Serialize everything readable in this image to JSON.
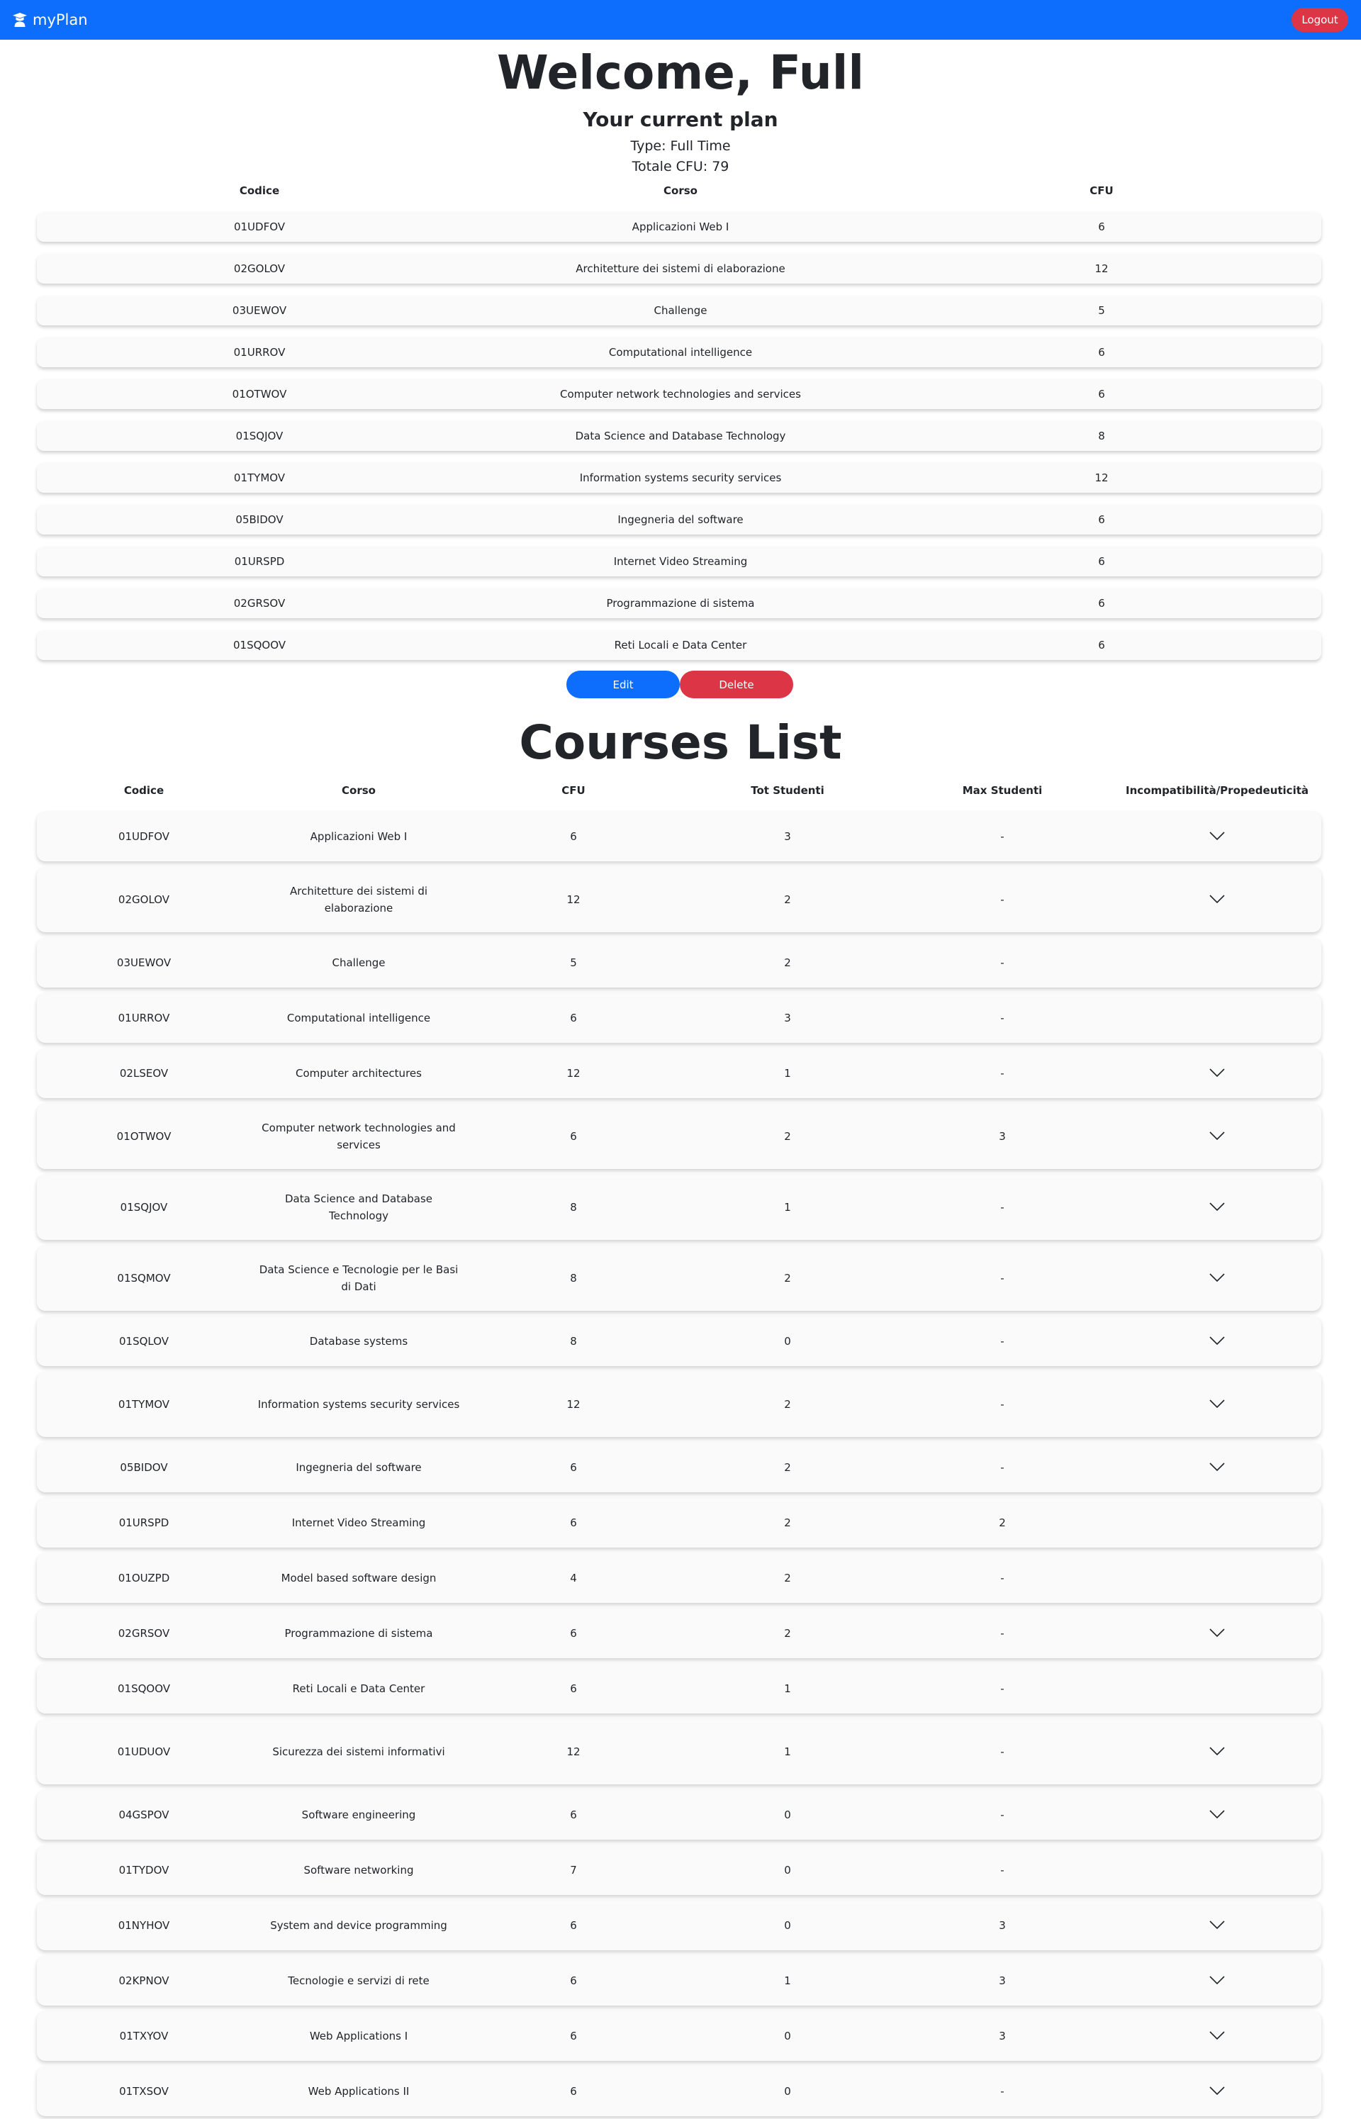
{
  "navbar": {
    "brand": "myPlan",
    "logout": "Logout"
  },
  "welcome": "Welcome, Full",
  "plan": {
    "title": "Your current plan",
    "type": "Type: Full Time",
    "total": "Totale CFU: 79",
    "headers": {
      "code": "Codice",
      "name": "Corso",
      "cfu": "CFU"
    },
    "rows": [
      {
        "code": "01UDFOV",
        "name": "Applicazioni Web I",
        "cfu": "6"
      },
      {
        "code": "02GOLOV",
        "name": "Architetture dei sistemi di elaborazione",
        "cfu": "12"
      },
      {
        "code": "03UEWOV",
        "name": "Challenge",
        "cfu": "5"
      },
      {
        "code": "01URROV",
        "name": "Computational intelligence",
        "cfu": "6"
      },
      {
        "code": "01OTWOV",
        "name": "Computer network technologies and services",
        "cfu": "6"
      },
      {
        "code": "01SQJOV",
        "name": "Data Science and Database Technology",
        "cfu": "8"
      },
      {
        "code": "01TYMOV",
        "name": "Information systems security services",
        "cfu": "12"
      },
      {
        "code": "05BIDOV",
        "name": "Ingegneria del software",
        "cfu": "6"
      },
      {
        "code": "01URSPD",
        "name": "Internet Video Streaming",
        "cfu": "6"
      },
      {
        "code": "02GRSOV",
        "name": "Programmazione di sistema",
        "cfu": "6"
      },
      {
        "code": "01SQOOV",
        "name": "Reti Locali e Data Center",
        "cfu": "6"
      }
    ],
    "edit": "Edit",
    "delete": "Delete"
  },
  "courses": {
    "title": "Courses List",
    "headers": {
      "code": "Codice",
      "name": "Corso",
      "cfu": "CFU",
      "tot": "Tot Studenti",
      "max": "Max Studenti",
      "incomp": "Incompatibilità/Propedeuticità"
    },
    "rows": [
      {
        "code": "01UDFOV",
        "name": "Applicazioni Web I",
        "cfu": "6",
        "tot": "3",
        "max": "-",
        "expand": true
      },
      {
        "code": "02GOLOV",
        "name": "Architetture dei sistemi di elaborazione",
        "cfu": "12",
        "tot": "2",
        "max": "-",
        "expand": true
      },
      {
        "code": "03UEWOV",
        "name": "Challenge",
        "cfu": "5",
        "tot": "2",
        "max": "-",
        "expand": false
      },
      {
        "code": "01URROV",
        "name": "Computational intelligence",
        "cfu": "6",
        "tot": "3",
        "max": "-",
        "expand": false
      },
      {
        "code": "02LSEOV",
        "name": "Computer architectures",
        "cfu": "12",
        "tot": "1",
        "max": "-",
        "expand": true
      },
      {
        "code": "01OTWOV",
        "name": "Computer network technologies and services",
        "cfu": "6",
        "tot": "2",
        "max": "3",
        "expand": true
      },
      {
        "code": "01SQJOV",
        "name": "Data Science and Database Technology",
        "cfu": "8",
        "tot": "1",
        "max": "-",
        "expand": true
      },
      {
        "code": "01SQMOV",
        "name": "Data Science e Tecnologie per le Basi di Dati",
        "cfu": "8",
        "tot": "2",
        "max": "-",
        "expand": true
      },
      {
        "code": "01SQLOV",
        "name": "Database systems",
        "cfu": "8",
        "tot": "0",
        "max": "-",
        "expand": true
      },
      {
        "code": "01TYMOV",
        "name": "Information systems security services",
        "cfu": "12",
        "tot": "2",
        "max": "-",
        "expand": true
      },
      {
        "code": "05BIDOV",
        "name": "Ingegneria del software",
        "cfu": "6",
        "tot": "2",
        "max": "-",
        "expand": true
      },
      {
        "code": "01URSPD",
        "name": "Internet Video Streaming",
        "cfu": "6",
        "tot": "2",
        "max": "2",
        "expand": false
      },
      {
        "code": "01OUZPD",
        "name": "Model based software design",
        "cfu": "4",
        "tot": "2",
        "max": "-",
        "expand": false
      },
      {
        "code": "02GRSOV",
        "name": "Programmazione di sistema",
        "cfu": "6",
        "tot": "2",
        "max": "-",
        "expand": true
      },
      {
        "code": "01SQOOV",
        "name": "Reti Locali e Data Center",
        "cfu": "6",
        "tot": "1",
        "max": "-",
        "expand": false
      },
      {
        "code": "01UDUOV",
        "name": "Sicurezza dei sistemi informativi",
        "cfu": "12",
        "tot": "1",
        "max": "-",
        "expand": true
      },
      {
        "code": "04GSPOV",
        "name": "Software engineering",
        "cfu": "6",
        "tot": "0",
        "max": "-",
        "expand": true
      },
      {
        "code": "01TYDOV",
        "name": "Software networking",
        "cfu": "7",
        "tot": "0",
        "max": "-",
        "expand": false
      },
      {
        "code": "01NYHOV",
        "name": "System and device programming",
        "cfu": "6",
        "tot": "0",
        "max": "3",
        "expand": true
      },
      {
        "code": "02KPNOV",
        "name": "Tecnologie e servizi di rete",
        "cfu": "6",
        "tot": "1",
        "max": "3",
        "expand": true
      },
      {
        "code": "01TXYOV",
        "name": "Web Applications I",
        "cfu": "6",
        "tot": "0",
        "max": "3",
        "expand": true
      },
      {
        "code": "01TXSOV",
        "name": "Web Applications II",
        "cfu": "6",
        "tot": "0",
        "max": "-",
        "expand": true
      }
    ]
  }
}
